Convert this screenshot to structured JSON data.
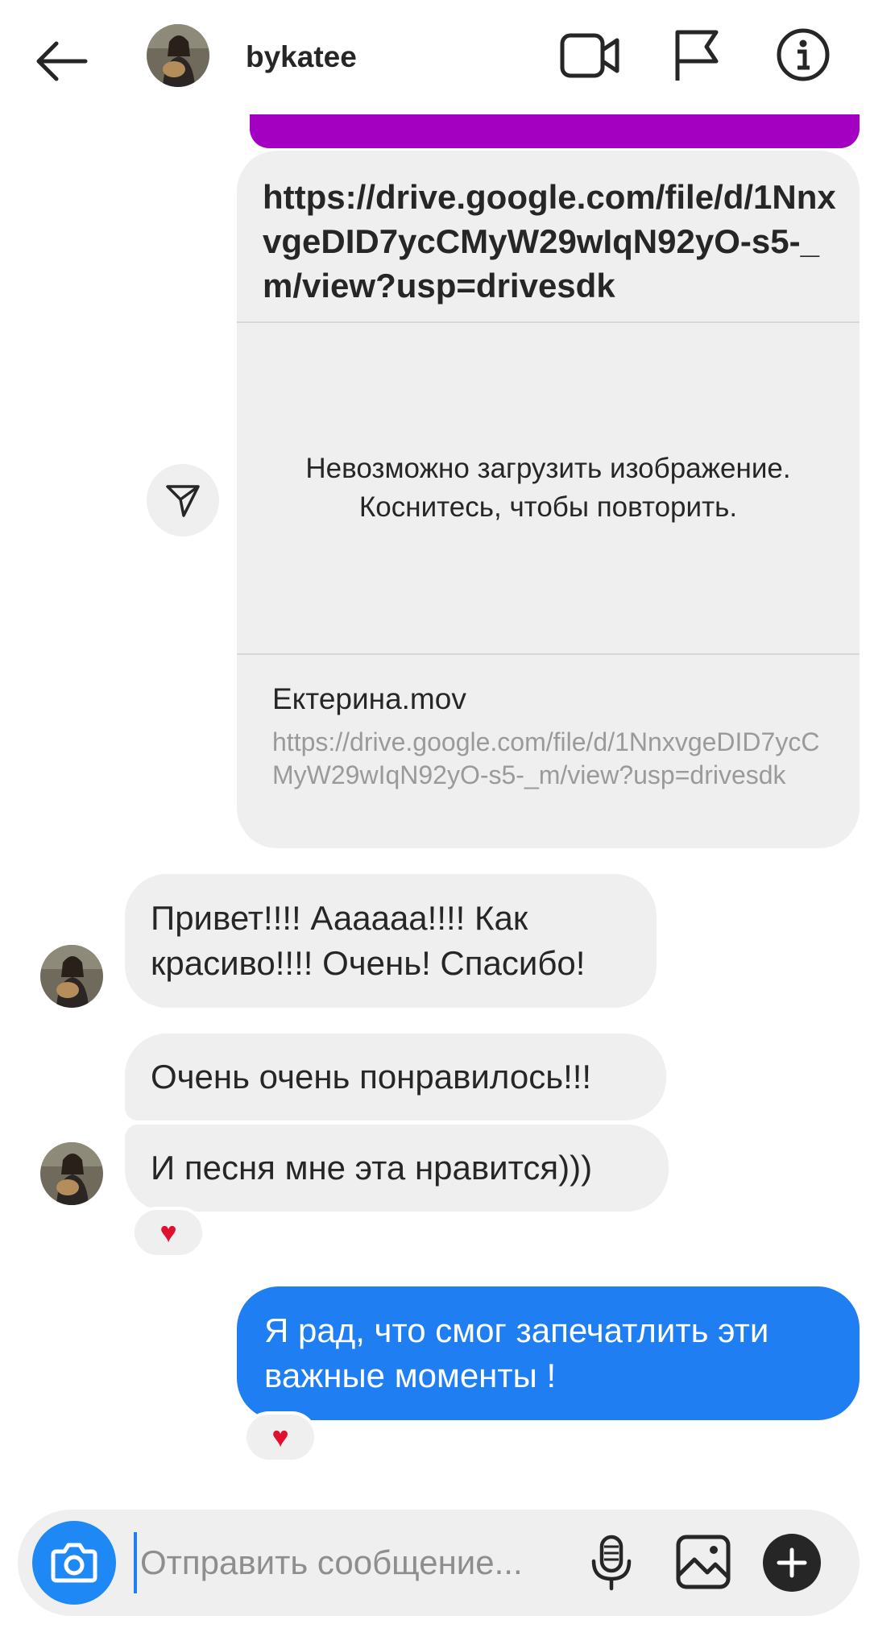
{
  "header": {
    "username": "bykatee"
  },
  "link_card": {
    "url": "https://drive.google.com/file/d/1NnxvgeDID7ycCMyW29wIqN92yO-s5-_m/view?usp=drivesdk",
    "preview_error": "Невозможно загрузить изображение.\nКоснитесь, чтобы повторить.",
    "file_name": "Ектерина.mov",
    "file_url": "https://drive.google.com/file/d/1NnxvgeDID7ycCMyW29wIqN92yO-s5-_m/view?usp=drivesdk"
  },
  "messages": {
    "received_1": "Привет!!!! Аааааа!!!! Как красиво!!!! Очень! Спасибо!",
    "received_2": "Очень очень понравилось!!!",
    "received_3": "И песня мне эта нравится)))",
    "sent_1": "Я рад, что смог запечатлить эти важные моменты !"
  },
  "reactions": {
    "reaction_1": "♥",
    "reaction_2": "♥"
  },
  "composer": {
    "placeholder": "Отправить сообщение..."
  },
  "colors": {
    "sent_bubble": "#1e7ef2",
    "purple_bubble": "#a300c2",
    "received_bubble": "#efefef",
    "camera_button": "#1e88f5",
    "heart": "#e0112e"
  },
  "icons": {
    "back": "arrow-left-icon",
    "video": "video-camera-icon",
    "report": "flag-icon",
    "info": "info-icon",
    "share": "paper-plane-icon",
    "camera": "camera-icon",
    "mic": "microphone-icon",
    "gallery": "image-icon",
    "plus": "plus-icon"
  }
}
